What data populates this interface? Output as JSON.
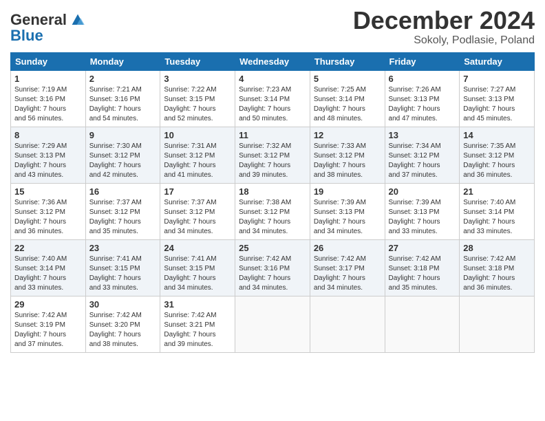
{
  "logo": {
    "line1": "General",
    "line2": "Blue"
  },
  "title": "December 2024",
  "location": "Sokoly, Podlasie, Poland",
  "weekdays": [
    "Sunday",
    "Monday",
    "Tuesday",
    "Wednesday",
    "Thursday",
    "Friday",
    "Saturday"
  ],
  "weeks": [
    [
      {
        "day": "1",
        "lines": [
          "Sunrise: 7:19 AM",
          "Sunset: 3:16 PM",
          "Daylight: 7 hours",
          "and 56 minutes."
        ]
      },
      {
        "day": "2",
        "lines": [
          "Sunrise: 7:21 AM",
          "Sunset: 3:16 PM",
          "Daylight: 7 hours",
          "and 54 minutes."
        ]
      },
      {
        "day": "3",
        "lines": [
          "Sunrise: 7:22 AM",
          "Sunset: 3:15 PM",
          "Daylight: 7 hours",
          "and 52 minutes."
        ]
      },
      {
        "day": "4",
        "lines": [
          "Sunrise: 7:23 AM",
          "Sunset: 3:14 PM",
          "Daylight: 7 hours",
          "and 50 minutes."
        ]
      },
      {
        "day": "5",
        "lines": [
          "Sunrise: 7:25 AM",
          "Sunset: 3:14 PM",
          "Daylight: 7 hours",
          "and 48 minutes."
        ]
      },
      {
        "day": "6",
        "lines": [
          "Sunrise: 7:26 AM",
          "Sunset: 3:13 PM",
          "Daylight: 7 hours",
          "and 47 minutes."
        ]
      },
      {
        "day": "7",
        "lines": [
          "Sunrise: 7:27 AM",
          "Sunset: 3:13 PM",
          "Daylight: 7 hours",
          "and 45 minutes."
        ]
      }
    ],
    [
      {
        "day": "8",
        "lines": [
          "Sunrise: 7:29 AM",
          "Sunset: 3:13 PM",
          "Daylight: 7 hours",
          "and 43 minutes."
        ]
      },
      {
        "day": "9",
        "lines": [
          "Sunrise: 7:30 AM",
          "Sunset: 3:12 PM",
          "Daylight: 7 hours",
          "and 42 minutes."
        ]
      },
      {
        "day": "10",
        "lines": [
          "Sunrise: 7:31 AM",
          "Sunset: 3:12 PM",
          "Daylight: 7 hours",
          "and 41 minutes."
        ]
      },
      {
        "day": "11",
        "lines": [
          "Sunrise: 7:32 AM",
          "Sunset: 3:12 PM",
          "Daylight: 7 hours",
          "and 39 minutes."
        ]
      },
      {
        "day": "12",
        "lines": [
          "Sunrise: 7:33 AM",
          "Sunset: 3:12 PM",
          "Daylight: 7 hours",
          "and 38 minutes."
        ]
      },
      {
        "day": "13",
        "lines": [
          "Sunrise: 7:34 AM",
          "Sunset: 3:12 PM",
          "Daylight: 7 hours",
          "and 37 minutes."
        ]
      },
      {
        "day": "14",
        "lines": [
          "Sunrise: 7:35 AM",
          "Sunset: 3:12 PM",
          "Daylight: 7 hours",
          "and 36 minutes."
        ]
      }
    ],
    [
      {
        "day": "15",
        "lines": [
          "Sunrise: 7:36 AM",
          "Sunset: 3:12 PM",
          "Daylight: 7 hours",
          "and 36 minutes."
        ]
      },
      {
        "day": "16",
        "lines": [
          "Sunrise: 7:37 AM",
          "Sunset: 3:12 PM",
          "Daylight: 7 hours",
          "and 35 minutes."
        ]
      },
      {
        "day": "17",
        "lines": [
          "Sunrise: 7:37 AM",
          "Sunset: 3:12 PM",
          "Daylight: 7 hours",
          "and 34 minutes."
        ]
      },
      {
        "day": "18",
        "lines": [
          "Sunrise: 7:38 AM",
          "Sunset: 3:12 PM",
          "Daylight: 7 hours",
          "and 34 minutes."
        ]
      },
      {
        "day": "19",
        "lines": [
          "Sunrise: 7:39 AM",
          "Sunset: 3:13 PM",
          "Daylight: 7 hours",
          "and 34 minutes."
        ]
      },
      {
        "day": "20",
        "lines": [
          "Sunrise: 7:39 AM",
          "Sunset: 3:13 PM",
          "Daylight: 7 hours",
          "and 33 minutes."
        ]
      },
      {
        "day": "21",
        "lines": [
          "Sunrise: 7:40 AM",
          "Sunset: 3:14 PM",
          "Daylight: 7 hours",
          "and 33 minutes."
        ]
      }
    ],
    [
      {
        "day": "22",
        "lines": [
          "Sunrise: 7:40 AM",
          "Sunset: 3:14 PM",
          "Daylight: 7 hours",
          "and 33 minutes."
        ]
      },
      {
        "day": "23",
        "lines": [
          "Sunrise: 7:41 AM",
          "Sunset: 3:15 PM",
          "Daylight: 7 hours",
          "and 33 minutes."
        ]
      },
      {
        "day": "24",
        "lines": [
          "Sunrise: 7:41 AM",
          "Sunset: 3:15 PM",
          "Daylight: 7 hours",
          "and 34 minutes."
        ]
      },
      {
        "day": "25",
        "lines": [
          "Sunrise: 7:42 AM",
          "Sunset: 3:16 PM",
          "Daylight: 7 hours",
          "and 34 minutes."
        ]
      },
      {
        "day": "26",
        "lines": [
          "Sunrise: 7:42 AM",
          "Sunset: 3:17 PM",
          "Daylight: 7 hours",
          "and 34 minutes."
        ]
      },
      {
        "day": "27",
        "lines": [
          "Sunrise: 7:42 AM",
          "Sunset: 3:18 PM",
          "Daylight: 7 hours",
          "and 35 minutes."
        ]
      },
      {
        "day": "28",
        "lines": [
          "Sunrise: 7:42 AM",
          "Sunset: 3:18 PM",
          "Daylight: 7 hours",
          "and 36 minutes."
        ]
      }
    ],
    [
      {
        "day": "29",
        "lines": [
          "Sunrise: 7:42 AM",
          "Sunset: 3:19 PM",
          "Daylight: 7 hours",
          "and 37 minutes."
        ]
      },
      {
        "day": "30",
        "lines": [
          "Sunrise: 7:42 AM",
          "Sunset: 3:20 PM",
          "Daylight: 7 hours",
          "and 38 minutes."
        ]
      },
      {
        "day": "31",
        "lines": [
          "Sunrise: 7:42 AM",
          "Sunset: 3:21 PM",
          "Daylight: 7 hours",
          "and 39 minutes."
        ]
      },
      null,
      null,
      null,
      null
    ]
  ]
}
